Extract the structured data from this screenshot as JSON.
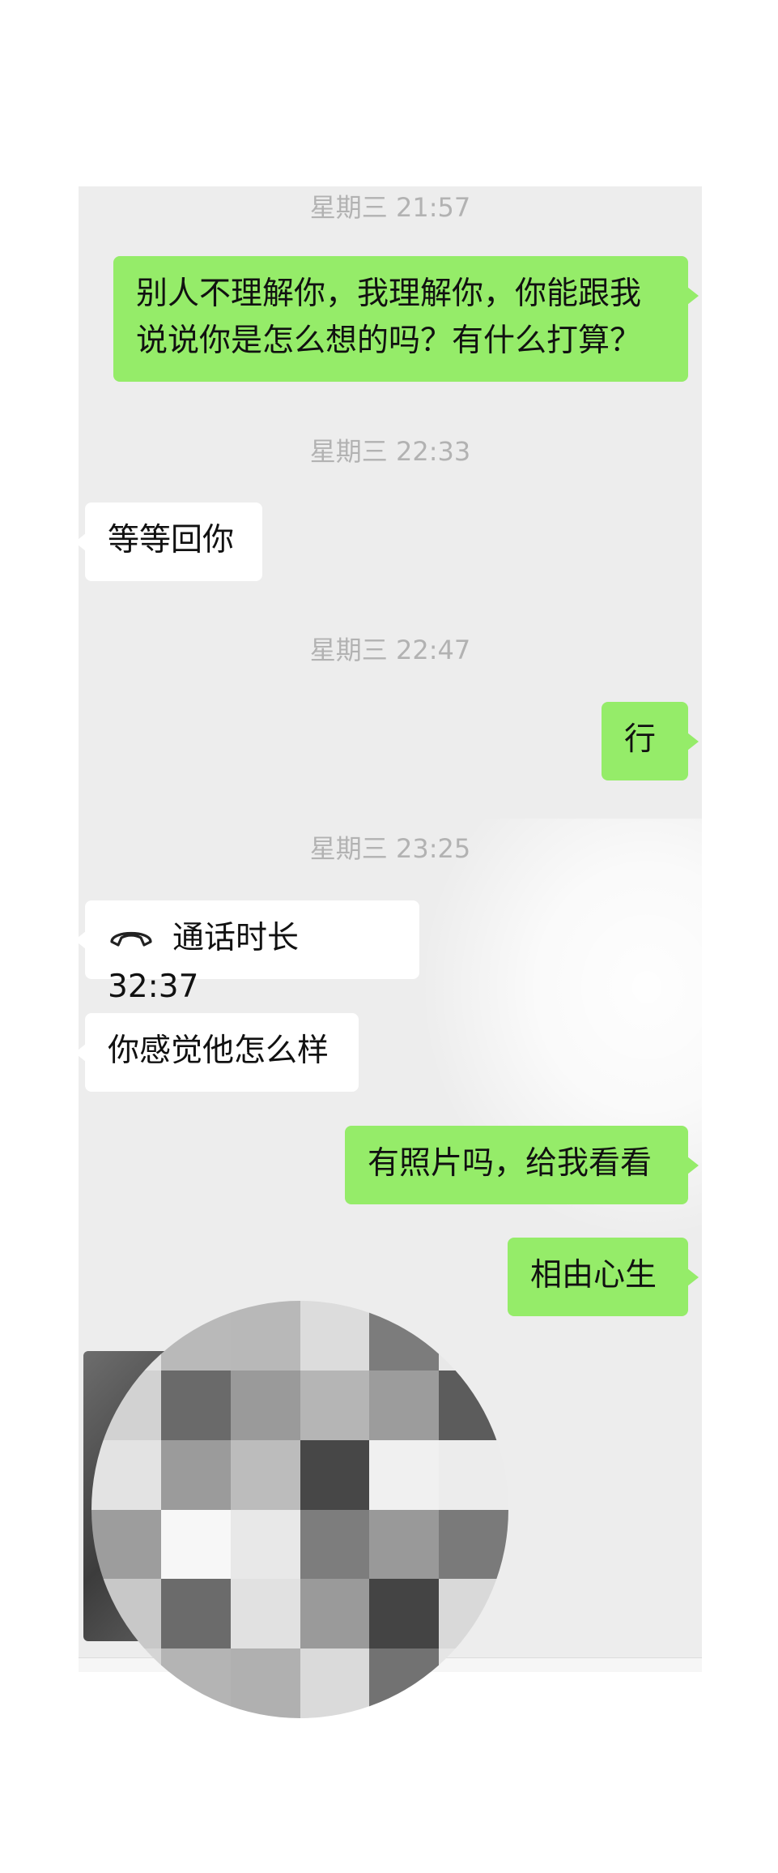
{
  "messages": [
    {
      "kind": "timestamp",
      "text": "星期三 21:57"
    },
    {
      "kind": "sent",
      "text": "别人不理解你，我理解你，你能跟我说说你是怎么想的吗？有什么打算？"
    },
    {
      "kind": "timestamp",
      "text": "星期三 22:33"
    },
    {
      "kind": "received",
      "text": "等等回你"
    },
    {
      "kind": "timestamp",
      "text": "星期三 22:47"
    },
    {
      "kind": "sent",
      "text": "行"
    },
    {
      "kind": "timestamp",
      "text": "星期三 23:25"
    },
    {
      "kind": "received_call",
      "text": "通话时长 32:37",
      "icon": "phone-hangup-icon"
    },
    {
      "kind": "received",
      "text": "你感觉他怎么样"
    },
    {
      "kind": "sent",
      "text": "有照片吗，给我看看"
    },
    {
      "kind": "sent",
      "text": "相由心生"
    },
    {
      "kind": "received_image",
      "note_visible": false
    }
  ],
  "colors": {
    "chat_background": "#ededed",
    "sent_bubble": "#95ec69",
    "received_bubble": "#ffffff",
    "timestamp_text": "#b2b2b2"
  },
  "mosaic_shades": [
    "#e2e2e2",
    "#b9b9b9",
    "#b8b8b8",
    "#dcdcdc",
    "#7c7c7c",
    "#e8e8e8",
    "#d2d2d2",
    "#6a6a6a",
    "#9a9a9a",
    "#b5b5b5",
    "#9c9c9c",
    "#5c5c5c",
    "#e3e3e3",
    "#9b9b9b",
    "#bcbcbc",
    "#474747",
    "#f0f0f0",
    "#ececec",
    "#9d9d9d",
    "#f7f7f7",
    "#e8e8e8",
    "#7d7d7d",
    "#999999",
    "#7a7a7a",
    "#c8c8c8",
    "#6b6b6b",
    "#e1e1e1",
    "#9a9a9a",
    "#444444",
    "#d9d9d9",
    "#d5d5d5",
    "#b4b4b4",
    "#b0b0b0",
    "#dadada",
    "#727272",
    "#e5e5e5"
  ]
}
